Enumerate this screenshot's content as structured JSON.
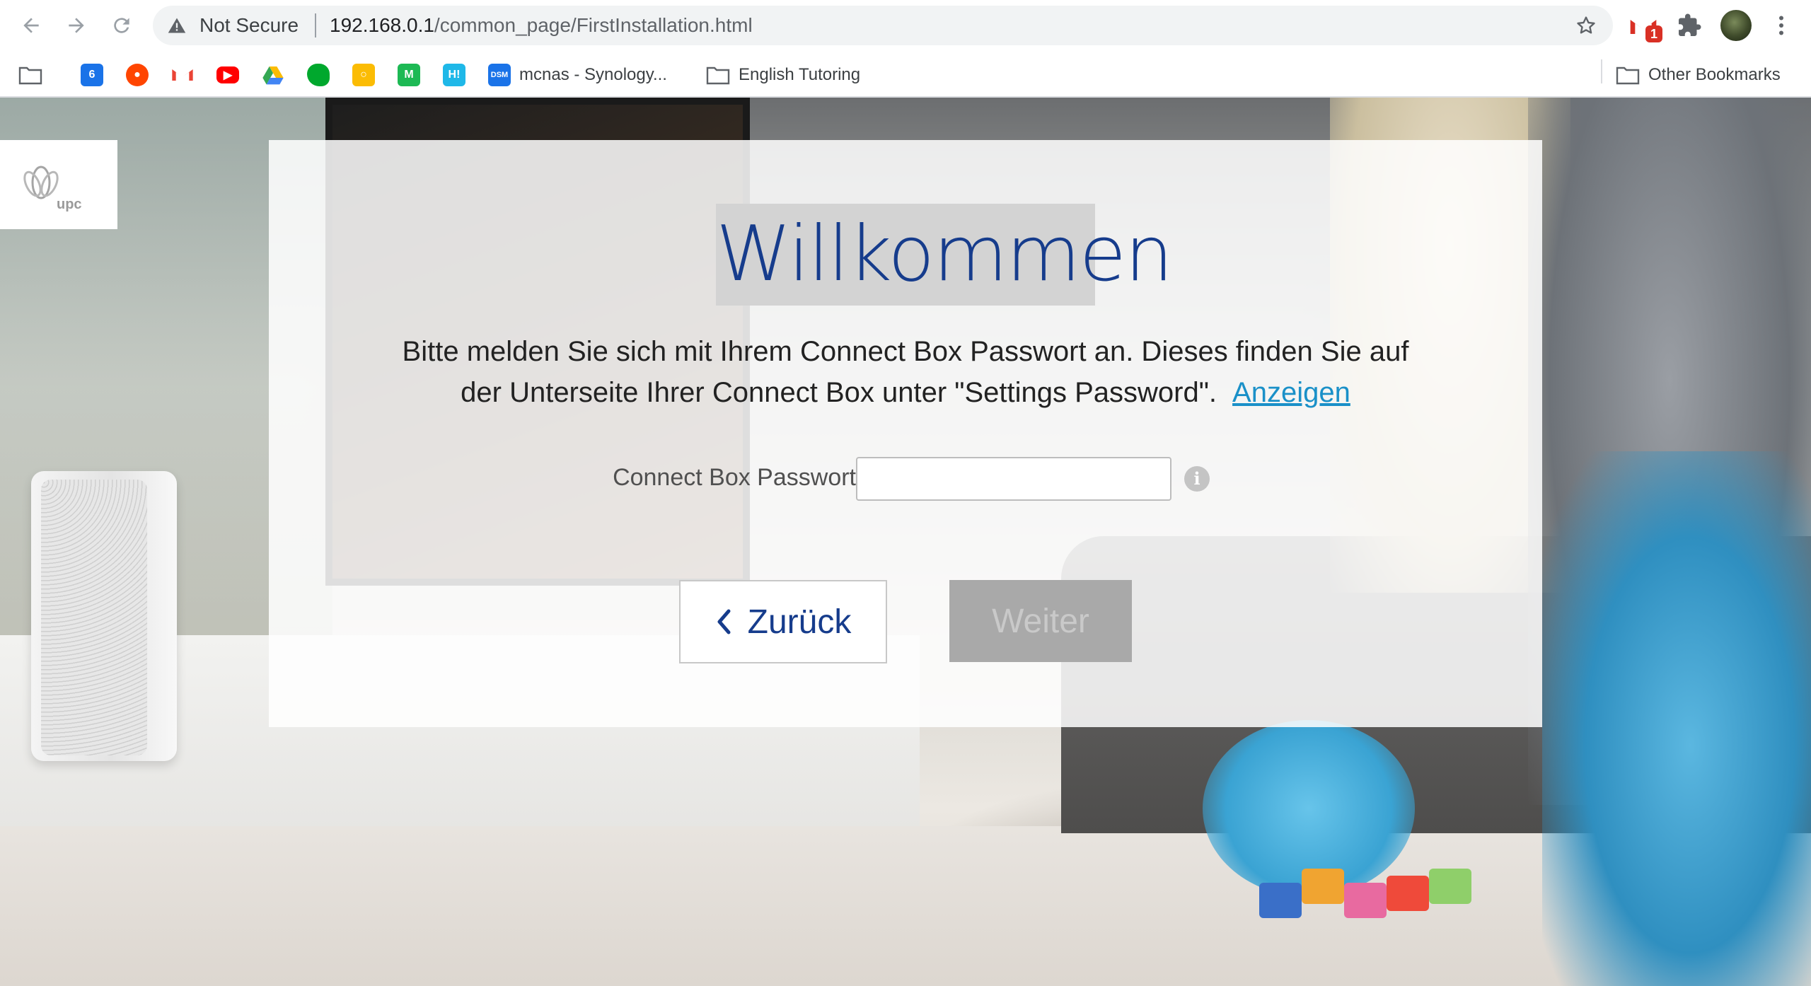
{
  "browser": {
    "omnibox": {
      "security_text": "Not Secure",
      "url_host": "192.168.0.1",
      "url_path": "/common_page/FirstInstallation.html"
    },
    "extensions": {
      "gmail_badge": "1"
    },
    "bookmarks": [
      {
        "icon": "calendar-icon",
        "label": "",
        "badge": "6"
      },
      {
        "icon": "reddit-icon",
        "label": ""
      },
      {
        "icon": "gmail-icon",
        "label": ""
      },
      {
        "icon": "youtube-icon",
        "label": ""
      },
      {
        "icon": "drive-icon",
        "label": ""
      },
      {
        "icon": "evernote-icon",
        "label": ""
      },
      {
        "icon": "keep-icon",
        "label": ""
      },
      {
        "icon": "m-icon",
        "label": ""
      },
      {
        "icon": "hi-icon",
        "label": ""
      },
      {
        "icon": "dsm-icon",
        "label": "mcnas - Synology...",
        "badge": "DSM"
      },
      {
        "icon": "folder-icon",
        "label": "English Tutoring"
      }
    ],
    "other_bookmarks": "Other Bookmarks"
  },
  "page": {
    "logo_text": "upc",
    "title": "Willkommen",
    "intro_line1": "Bitte melden Sie sich mit Ihrem Connect Box Passwort an. Dieses finden Sie auf",
    "intro_line2": "der Unterseite Ihrer Connect Box unter \"Settings Password\".",
    "intro_link": "Anzeigen",
    "password_label": "Connect Box Passwort",
    "password_value": "",
    "info_icon": "i",
    "back_button": "Zurück",
    "next_button": "Weiter"
  },
  "colors": {
    "title_blue": "#163c8c",
    "link_blue": "#1a90c8",
    "disabled_button": "#a9a9a9"
  }
}
